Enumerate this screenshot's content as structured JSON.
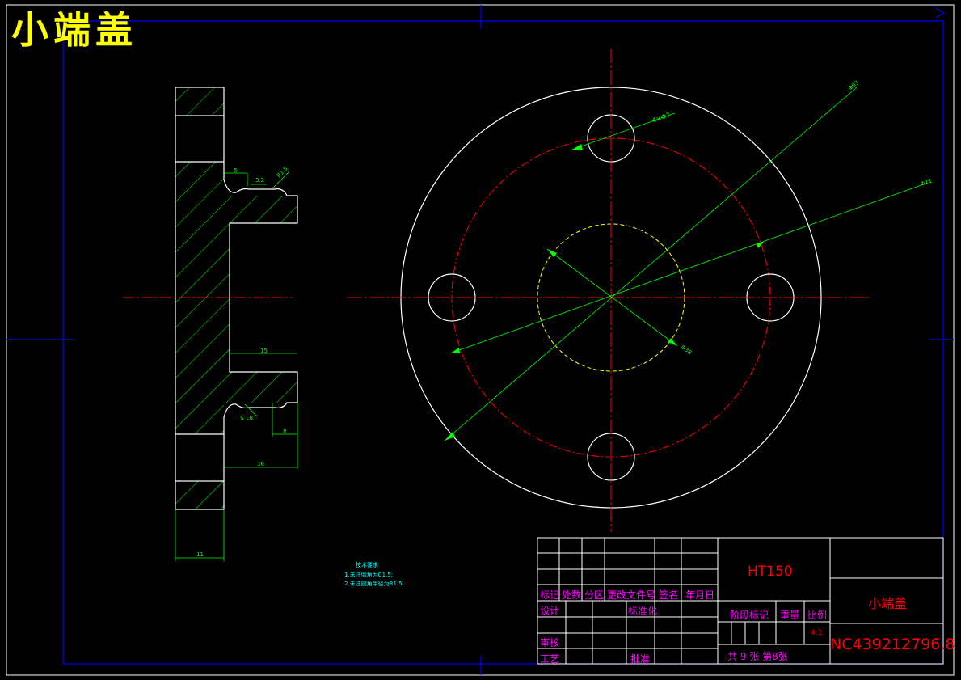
{
  "title": "小端盖",
  "colors": {
    "background": "#000000",
    "outline": "#ffffff",
    "frame": "#0000ff",
    "dimension": "#00ff00",
    "centerline": "#ff0000",
    "hidden_circle": "#ffff00",
    "note": "#00ffff",
    "titleblock_text": "#ff00ff",
    "title_yellow": "#ffff00"
  },
  "section_view": {
    "dims": [
      "5",
      "3.2",
      "R1.5",
      "15",
      "R1.5",
      "8",
      "16",
      "11"
    ]
  },
  "front_view": {
    "callouts": {
      "outer": "Φ93",
      "bolt_pcd": "Φ71",
      "holes": "4×Φ7",
      "hub": "Φ38"
    }
  },
  "notes": {
    "heading": "技术要求",
    "lines": [
      "1.未注倒角为C1.5;",
      "2.未注圆角半径为R1.5."
    ]
  },
  "title_block": {
    "material": "HT150",
    "part_name": "小端盖",
    "drawing_code": "NC439212796.8",
    "rev_headers": [
      "标记",
      "处数",
      "分区",
      "更改文件号",
      "签名",
      "年月日"
    ],
    "design": "设计",
    "standardize": "标准化",
    "review": "审核",
    "process": "工艺",
    "approve": "批准",
    "stage_mark": "阶段标记",
    "weight": "重量",
    "scale": "比例",
    "scale_value": "4:1",
    "sheets": "共 9 张 第8张"
  }
}
